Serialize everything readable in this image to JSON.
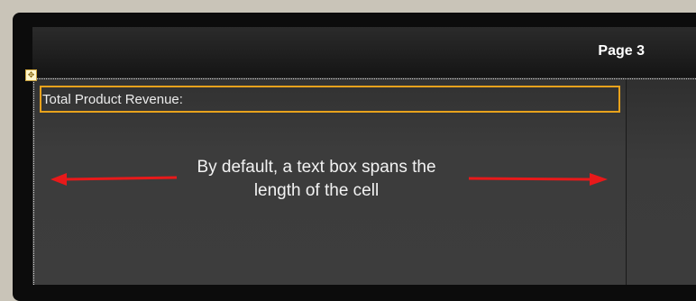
{
  "header": {
    "page_title": "Page 3"
  },
  "cell": {
    "text_box_value": "Total Product Revenue:"
  },
  "annotation": {
    "line1": "By default, a text box spans the",
    "line2": "length of the cell",
    "arrow_color": "#e8191a"
  },
  "colors": {
    "selection_border": "#e8a21c",
    "background": "#3b3b3b",
    "header": "#1f1f1f"
  },
  "icons": {
    "move_handle": "move-arrows-icon"
  }
}
